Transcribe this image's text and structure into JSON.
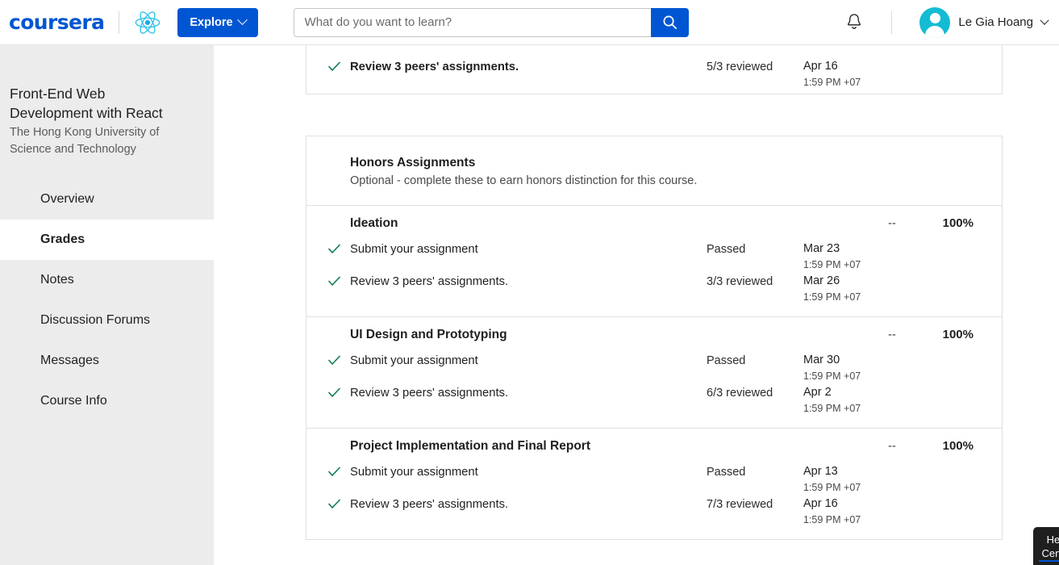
{
  "topnav": {
    "logo_text": "coursera",
    "course_logo_icon": "react-atom-icon",
    "explore_label": "Explore",
    "search": {
      "placeholder": "What do you want to learn?",
      "value": "",
      "icon": "search-icon"
    },
    "notifications_icon": "bell-icon",
    "user": {
      "name": "Le Gia Hoang",
      "avatar_icon": "user-avatar-icon",
      "chevron_icon": "chevron-down-icon"
    },
    "accent_color": "#0056d2"
  },
  "sidebar": {
    "course_title": "Front-End Web Development with React",
    "university": "The Hong Kong University of Science and Technology",
    "items": [
      {
        "label": "Overview",
        "active": false
      },
      {
        "label": "Grades",
        "active": true
      },
      {
        "label": "Notes",
        "active": false
      },
      {
        "label": "Discussion Forums",
        "active": false
      },
      {
        "label": "Messages",
        "active": false
      },
      {
        "label": "Course Info",
        "active": false
      }
    ],
    "background_color": "#ececec"
  },
  "main": {
    "partial_card_row": {
      "check_icon": "check-icon",
      "label": "Review 3 peers' assignments.",
      "status": "5/3 reviewed",
      "date": "Apr 16",
      "time": "1:59 PM +07"
    },
    "honors": {
      "title": "Honors Assignments",
      "subtitle": "Optional - complete these to earn honors distinction for this course.",
      "groups": [
        {
          "name": "Ideation",
          "grade_dash": "--",
          "percent": "100%",
          "rows": [
            {
              "check_icon": "check-icon",
              "label": "Submit your assignment",
              "status": "Passed",
              "date": "Mar 23",
              "time": "1:59 PM +07"
            },
            {
              "check_icon": "check-icon",
              "label": "Review 3 peers' assignments.",
              "status": "3/3 reviewed",
              "date": "Mar 26",
              "time": "1:59 PM +07"
            }
          ]
        },
        {
          "name": "UI Design and Prototyping",
          "grade_dash": "--",
          "percent": "100%",
          "rows": [
            {
              "check_icon": "check-icon",
              "label": "Submit your assignment",
              "status": "Passed",
              "date": "Mar 30",
              "time": "1:59 PM +07"
            },
            {
              "check_icon": "check-icon",
              "label": "Review 3 peers' assignments.",
              "status": "6/3 reviewed",
              "date": "Apr 2",
              "time": "1:59 PM +07"
            }
          ]
        },
        {
          "name": "Project Implementation and Final Report",
          "grade_dash": "--",
          "percent": "100%",
          "rows": [
            {
              "check_icon": "check-icon",
              "label": "Submit your assignment",
              "status": "Passed",
              "date": "Apr 13",
              "time": "1:59 PM +07"
            },
            {
              "check_icon": "check-icon",
              "label": "Review 3 peers' assignments.",
              "status": "7/3 reviewed",
              "date": "Apr 16",
              "time": "1:59 PM +07"
            }
          ]
        }
      ]
    },
    "check_color": "#0a7d4a"
  },
  "help_widget": {
    "line1": "Help",
    "line2": "Center",
    "background_color": "#1f1f1f"
  }
}
